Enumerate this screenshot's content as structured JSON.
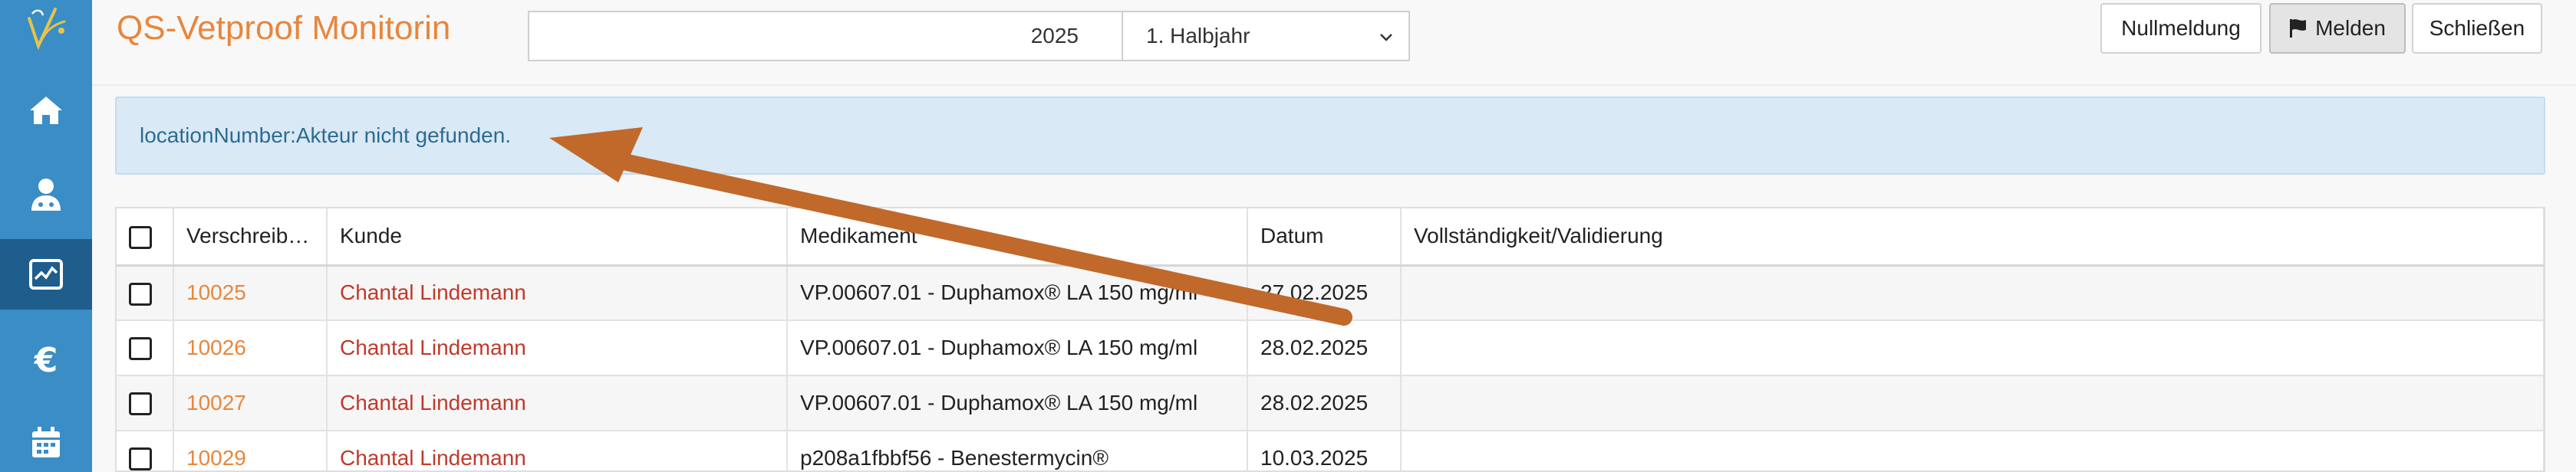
{
  "header": {
    "title": "QS-Vetproof Monitorin",
    "year_value": "2025",
    "period_selected": "1. Halbjahr",
    "buttons": {
      "nullmeldung": "Nullmeldung",
      "melden": "Melden",
      "schliessen": "Schließen"
    }
  },
  "sidebar": {
    "items": [
      {
        "icon": "home-icon"
      },
      {
        "icon": "vet-user-icon"
      },
      {
        "icon": "monitor-chart-icon",
        "active": true
      },
      {
        "icon": "euro-icon",
        "glyph": "€"
      },
      {
        "icon": "calendar-icon"
      }
    ]
  },
  "alert": {
    "message": "locationNumber:Akteur nicht gefunden."
  },
  "table": {
    "columns": [
      "Verschreib…",
      "Kunde",
      "Medikament",
      "Datum",
      "Vollständigkeit/Validierung"
    ],
    "rows": [
      {
        "id": "10025",
        "kunde": "Chantal Lindemann",
        "medikament": "VP.00607.01 - Duphamox® LA 150 mg/ml",
        "datum": "27.02.2025",
        "status": ""
      },
      {
        "id": "10026",
        "kunde": "Chantal Lindemann",
        "medikament": "VP.00607.01 - Duphamox® LA 150 mg/ml",
        "datum": "28.02.2025",
        "status": ""
      },
      {
        "id": "10027",
        "kunde": "Chantal Lindemann",
        "medikament": "VP.00607.01 - Duphamox® LA 150 mg/ml",
        "datum": "28.02.2025",
        "status": ""
      },
      {
        "id": "10029",
        "kunde": "Chantal Lindemann",
        "medikament": "p208a1fbbf56 - Benestermycin®",
        "datum": "10.03.2025",
        "status": ""
      }
    ]
  },
  "colors": {
    "sidebar": "#3a8dc5",
    "sidebar_active": "#1e5d8c",
    "title_orange": "#e8863c",
    "alert_bg": "#d9e9f5",
    "arrow": "#c0692a"
  }
}
